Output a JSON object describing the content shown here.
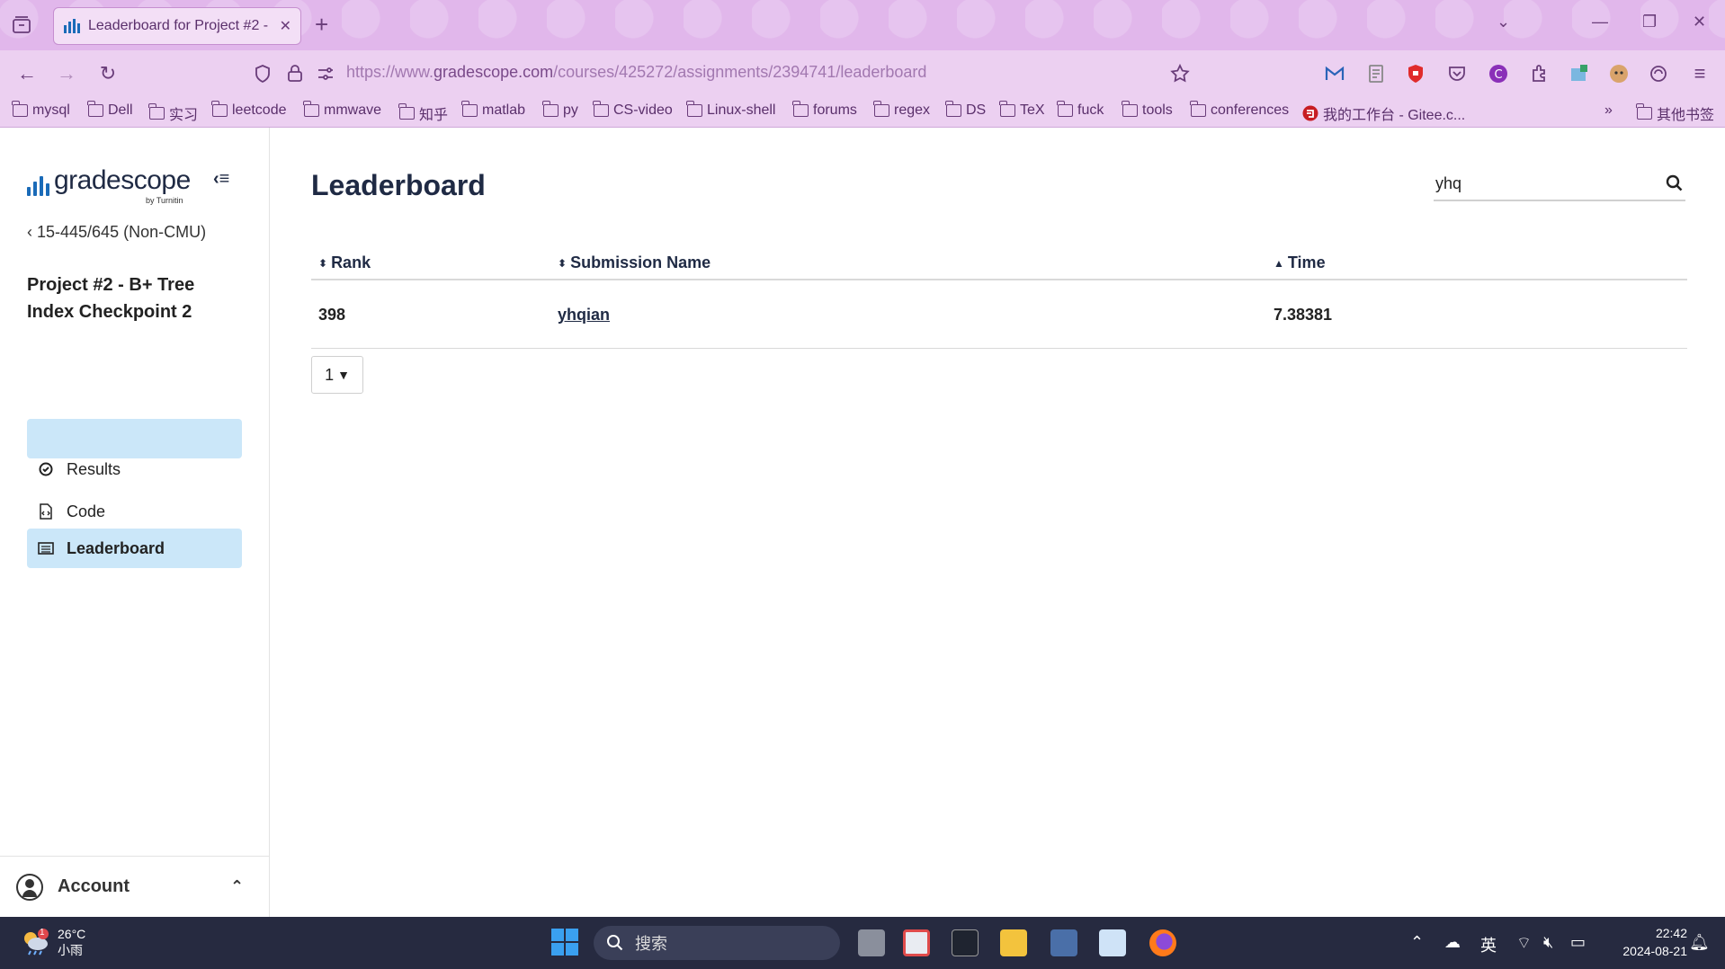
{
  "browser": {
    "tab_title": "Leaderboard for Project #2 -",
    "url_prefix": "https://www.",
    "url_host": "gradescope.com",
    "url_path": "/courses/425272/assignments/2394741/leaderboard",
    "bookmarks": [
      "mysql",
      "Dell",
      "实习",
      "leetcode",
      "mmwave",
      "知乎",
      "matlab",
      "py",
      "CS-video",
      "Linux-shell",
      "forums",
      "regex",
      "DS",
      "TeX",
      "fuck",
      "tools",
      "conferences",
      "我的工作台 - Gitee.c...",
      "其他书签"
    ]
  },
  "sidebar": {
    "logo_text": "gradescope",
    "logo_sub": "by Turnitin",
    "course_link": "15-445/645 (Non-CMU)",
    "assignment_title": "Project #2 - B+ Tree Index Checkpoint 2",
    "items": [
      {
        "label": "Results",
        "icon": "check-circle-icon"
      },
      {
        "label": "Code",
        "icon": "code-file-icon"
      },
      {
        "label": "Leaderboard",
        "icon": "leaderboard-icon",
        "active": true
      }
    ],
    "account_label": "Account"
  },
  "main": {
    "title": "Leaderboard",
    "search_value": "yhq",
    "columns": {
      "rank": "Rank",
      "submission": "Submission Name",
      "time": "Time"
    },
    "rows": [
      {
        "rank": "398",
        "submission": "yhqian",
        "time": "7.38381"
      }
    ],
    "page_selector": "1"
  },
  "taskbar": {
    "weather_temp": "26°C",
    "weather_desc": "小雨",
    "weather_badge": "1",
    "search_label": "搜索",
    "ime": "英",
    "time": "22:42",
    "date": "2024-08-21"
  },
  "colors": {
    "tabbar": "#e1b7eb",
    "navbar": "#ecd0f1",
    "accent_active": "#cbe7f9",
    "brand_blue": "#1a6bb8",
    "taskbar": "#262a40"
  }
}
